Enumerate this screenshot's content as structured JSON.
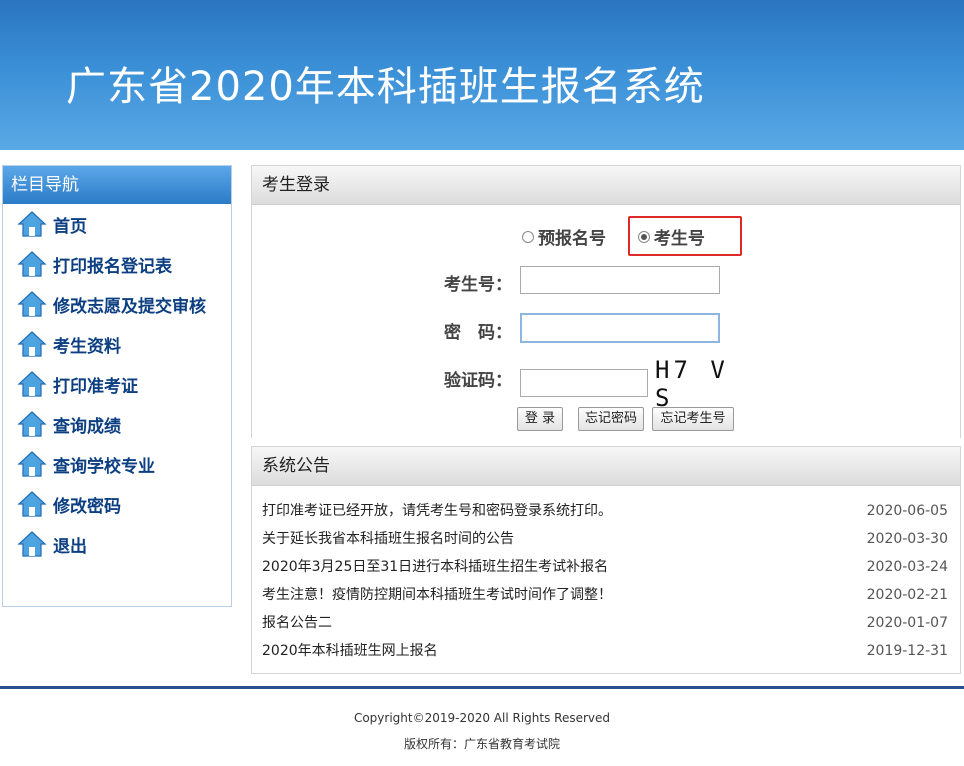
{
  "header": {
    "title": "广东省2020年本科插班生报名系统"
  },
  "sidebar": {
    "title": "栏目导航",
    "items": [
      {
        "label": "首页"
      },
      {
        "label": "打印报名登记表"
      },
      {
        "label": "修改志愿及提交审核"
      },
      {
        "label": "考生资料"
      },
      {
        "label": "打印准考证"
      },
      {
        "label": "查询成绩"
      },
      {
        "label": "查询学校专业"
      },
      {
        "label": "修改密码"
      },
      {
        "label": "退出"
      }
    ]
  },
  "login": {
    "title": "考生登录",
    "radio_options": [
      "预报名号",
      "考生号"
    ],
    "selected": "考生号",
    "fields": {
      "id_label": "考生号：",
      "password_label": "密　码：",
      "captcha_label": "验证码："
    },
    "captcha_text": "H7 V S",
    "buttons": {
      "login": "登 录",
      "forgot_password": "忘记密码",
      "forgot_id": "忘记考生号"
    }
  },
  "notice": {
    "title": "系统公告",
    "items": [
      {
        "text": "打印准考证已经开放，请凭考生号和密码登录系统打印。",
        "date": "2020-06-05"
      },
      {
        "text": "关于延长我省本科插班生报名时间的公告",
        "date": "2020-03-30"
      },
      {
        "text": "2020年3月25日至31日进行本科插班生招生考试补报名",
        "date": "2020-03-24"
      },
      {
        "text": "考生注意！疫情防控期间本科插班生考试时间作了调整！",
        "date": "2020-02-21"
      },
      {
        "text": "报名公告二",
        "date": "2020-01-07"
      },
      {
        "text": "2020年本科插班生网上报名",
        "date": "2019-12-31"
      }
    ]
  },
  "footer": {
    "copyright": "Copyright©2019-2020 All Rights Reserved",
    "owner": "版权所有：广东省教育考试院"
  },
  "colors": {
    "header_blue": "#2a74c0",
    "nav_text": "#0c3f82",
    "highlight_red": "#e02a2a"
  }
}
